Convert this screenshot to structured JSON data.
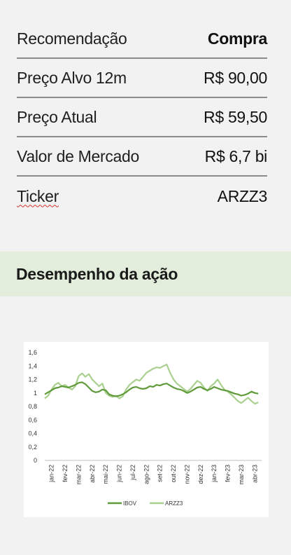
{
  "info": {
    "rows": [
      {
        "label": "Recomendação",
        "value": "Compra"
      },
      {
        "label": "Preço Alvo 12m",
        "value": "R$ 90,00"
      },
      {
        "label": "Preço Atual",
        "value": "R$ 59,50"
      },
      {
        "label": "Valor de Mercado",
        "value": "R$ 6,7 bi"
      },
      {
        "label": "Ticker",
        "value": "ARZZ3"
      }
    ]
  },
  "section": {
    "title": "Desempenho da ação"
  },
  "colors": {
    "ibov": "#5f9b3a",
    "arzz3": "#a9d08e",
    "banner": "#e2eedb"
  },
  "chart_data": {
    "type": "line",
    "title": "",
    "xlabel": "",
    "ylabel": "",
    "ylim": [
      0,
      1.6
    ],
    "y_ticks": [
      "0",
      "0,2",
      "0,4",
      "0,6",
      "0,8",
      "1",
      "1,2",
      "1,4",
      "1,6"
    ],
    "categories": [
      "jan-22",
      "fev-22",
      "mar-22",
      "abr-22",
      "mai-22",
      "jun-22",
      "jul-22",
      "ago-22",
      "set-22",
      "out-22",
      "nov-22",
      "dez-22",
      "jan-23",
      "fev-23",
      "mar-23",
      "abr-23"
    ],
    "x": [
      0,
      0.25,
      0.5,
      0.75,
      1,
      1.25,
      1.5,
      1.75,
      2,
      2.25,
      2.5,
      2.75,
      3,
      3.25,
      3.5,
      3.75,
      4,
      4.25,
      4.5,
      4.75,
      5,
      5.25,
      5.5,
      5.75,
      6,
      6.25,
      6.5,
      6.75,
      7,
      7.25,
      7.5,
      7.75,
      8,
      8.25,
      8.5,
      8.75,
      9,
      9.25,
      9.5,
      9.75,
      10,
      10.25,
      10.5,
      10.75,
      11,
      11.25,
      11.5,
      11.75,
      12,
      12.25,
      12.5,
      12.75,
      13,
      13.25,
      13.5,
      13.75,
      14,
      14.25,
      14.5,
      14.75,
      15,
      15.25,
      15.5,
      15.75
    ],
    "series": [
      {
        "name": "IBOV",
        "values": [
          0.98,
          1.01,
          1.04,
          1.07,
          1.08,
          1.1,
          1.09,
          1.08,
          1.1,
          1.12,
          1.15,
          1.16,
          1.13,
          1.08,
          1.03,
          1.01,
          1.02,
          1.05,
          1.04,
          0.98,
          0.96,
          0.95,
          0.96,
          0.98,
          1.01,
          1.05,
          1.08,
          1.09,
          1.07,
          1.06,
          1.07,
          1.1,
          1.09,
          1.12,
          1.11,
          1.13,
          1.14,
          1.11,
          1.08,
          1.06,
          1.05,
          1.03,
          1.0,
          1.02,
          1.05,
          1.08,
          1.09,
          1.06,
          1.04,
          1.06,
          1.09,
          1.07,
          1.05,
          1.04,
          1.03,
          1.01,
          0.99,
          0.98,
          0.96,
          0.97,
          0.99,
          1.02,
          1.0,
          0.99
        ]
      },
      {
        "name": "ARZZ3",
        "values": [
          0.92,
          0.96,
          1.05,
          1.12,
          1.15,
          1.1,
          1.12,
          1.08,
          1.05,
          1.1,
          1.25,
          1.29,
          1.24,
          1.28,
          1.2,
          1.15,
          1.1,
          1.14,
          1.0,
          0.96,
          0.94,
          0.96,
          0.92,
          0.95,
          1.05,
          1.12,
          1.16,
          1.2,
          1.18,
          1.24,
          1.3,
          1.33,
          1.36,
          1.38,
          1.37,
          1.4,
          1.42,
          1.3,
          1.2,
          1.14,
          1.1,
          1.06,
          1.02,
          1.06,
          1.12,
          1.18,
          1.15,
          1.08,
          1.03,
          1.1,
          1.14,
          1.2,
          1.12,
          1.05,
          1.02,
          0.98,
          0.93,
          0.88,
          0.85,
          0.89,
          0.93,
          0.88,
          0.84,
          0.86
        ]
      }
    ],
    "legend": [
      "IBOV",
      "ARZZ3"
    ],
    "legend_position": "bottom",
    "grid": false
  }
}
